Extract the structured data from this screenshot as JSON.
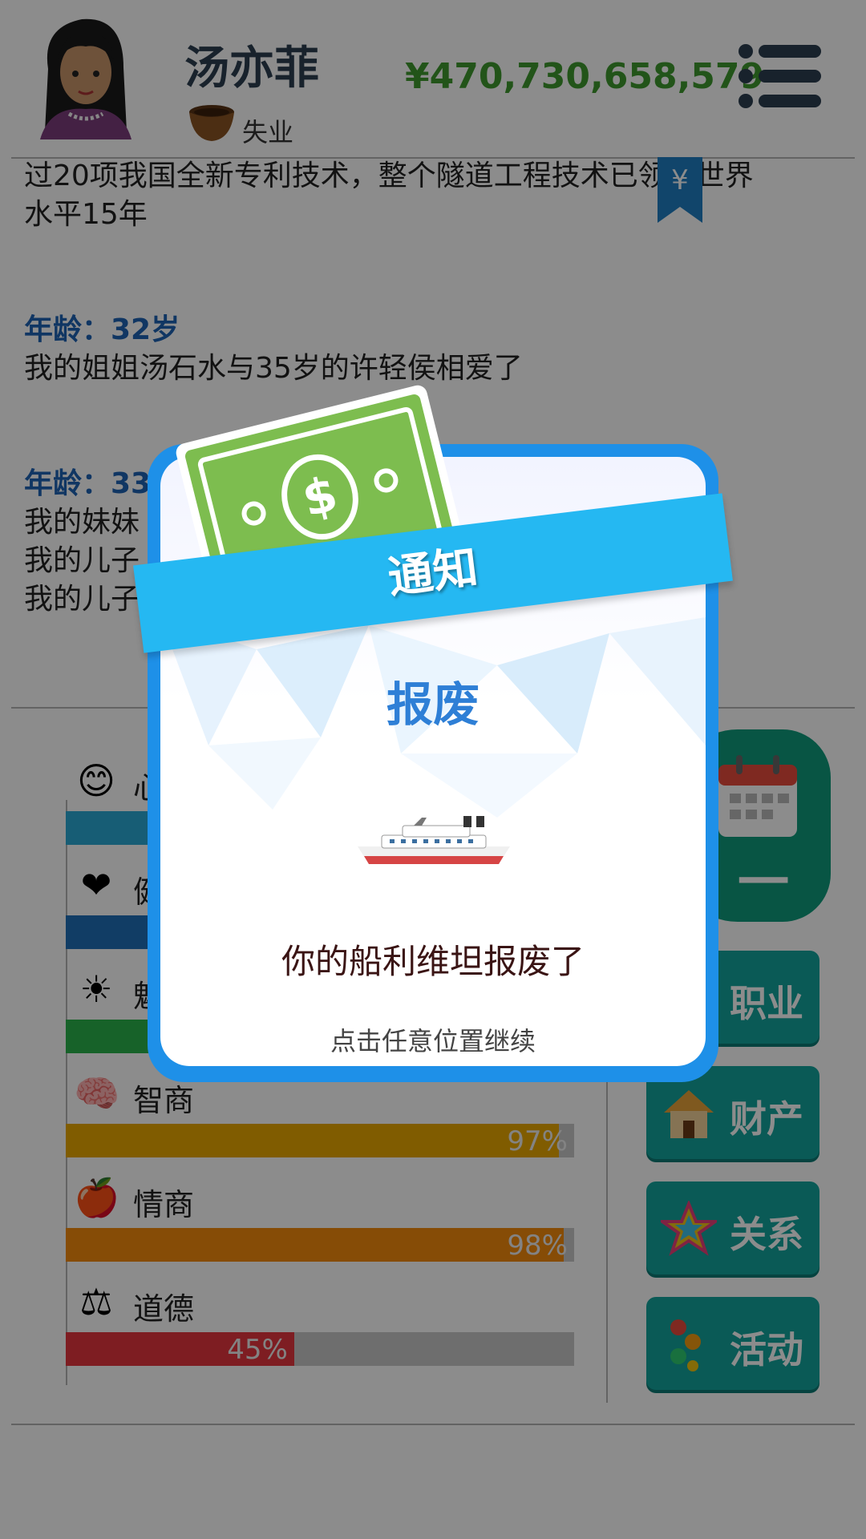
{
  "header": {
    "name": "汤亦菲",
    "job_status": "失业",
    "money": "¥470,730,658,579",
    "job_icon": "bowl-icon",
    "menu_icon": "menu-list-icon"
  },
  "log": {
    "lines": [
      {
        "type": "text",
        "text": "过20项我国全新专利技术，整个隧道工程技术已领先世界"
      },
      {
        "type": "text",
        "text": "水平15年"
      },
      {
        "type": "gap"
      },
      {
        "type": "age",
        "text": "年龄：32岁"
      },
      {
        "type": "text",
        "text": "我的姐姐汤石水与35岁的许轻侯相爱了"
      },
      {
        "type": "gap"
      },
      {
        "type": "age",
        "text": "年龄：33"
      },
      {
        "type": "text",
        "text": "我的妹妹"
      },
      {
        "type": "text",
        "text": "我的儿子"
      },
      {
        "type": "text",
        "text": "我的儿子"
      }
    ],
    "bookmark_glyph": "¥"
  },
  "stats": [
    {
      "icon": "smiley-icon",
      "glyph": "😊",
      "label": "心",
      "value": 1.0,
      "color": "#2aa9d6",
      "pct": ""
    },
    {
      "icon": "heart-icon",
      "glyph": "❤",
      "label": "健",
      "value": 1.0,
      "color": "#1f6fb8",
      "pct": ""
    },
    {
      "icon": "sun-icon",
      "glyph": "☀",
      "label": "魅",
      "value": 1.0,
      "color": "#2bb24c",
      "pct": ""
    },
    {
      "icon": "brain-icon",
      "glyph": "🧠",
      "label": "智商",
      "value": 0.97,
      "color": "#e9a800",
      "pct": "97%"
    },
    {
      "icon": "apple-icon",
      "glyph": "🍎",
      "label": "情商",
      "value": 0.98,
      "color": "#f58a0b",
      "pct": "98%"
    },
    {
      "icon": "scale-icon",
      "glyph": "⚖",
      "label": "道德",
      "value": 0.45,
      "color": "#e6353f",
      "pct": "45%"
    }
  ],
  "side_buttons": {
    "age_button": "一年",
    "career": "职业",
    "assets": "财产",
    "relations": "关系",
    "activities": "活动"
  },
  "dialog": {
    "ribbon_title": "通知",
    "title": "报废",
    "message": "你的船利维坦报废了",
    "hint": "点击任意位置继续",
    "image": "ship-icon"
  },
  "colors": {
    "money": "#3e9a2e",
    "dialog_border": "#1e90e8",
    "ribbon": "#25b8f2",
    "title": "#2e7fd6",
    "button_teal": "#13a59d"
  }
}
